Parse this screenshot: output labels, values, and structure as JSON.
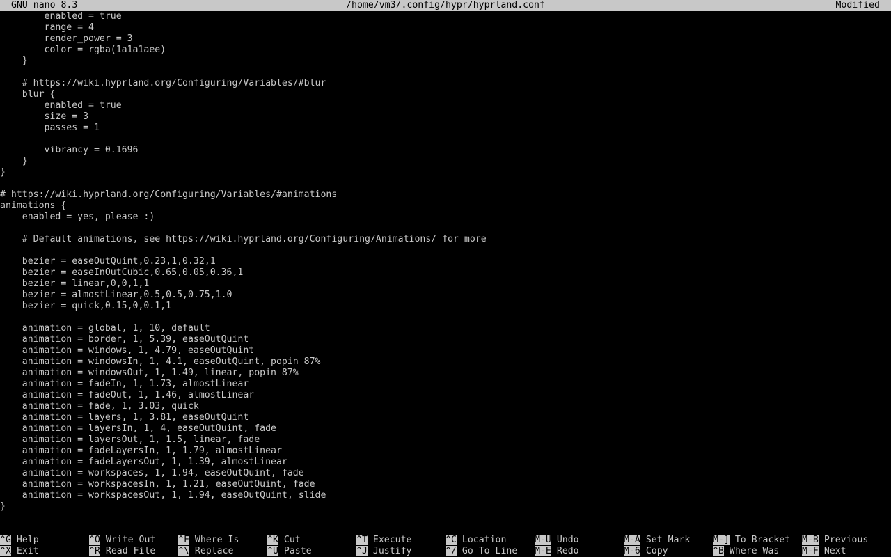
{
  "titlebar": {
    "app": "GNU nano 8.3",
    "file": "/home/vm3/.config/hypr/hyprland.conf",
    "state": "Modified"
  },
  "editor": {
    "lines": [
      "        enabled = true",
      "        range = 4",
      "        render_power = 3",
      "        color = rgba(1a1a1aee)",
      "    }",
      "",
      "    # https://wiki.hyprland.org/Configuring/Variables/#blur",
      "    blur {",
      "        enabled = true",
      "        size = 3",
      "        passes = 1",
      "",
      "        vibrancy = 0.1696",
      "    }",
      "}",
      "",
      "# https://wiki.hyprland.org/Configuring/Variables/#animations",
      "animations {",
      "    enabled = yes, please :)",
      "",
      "    # Default animations, see https://wiki.hyprland.org/Configuring/Animations/ for more",
      "",
      "    bezier = easeOutQuint,0.23,1,0.32,1",
      "    bezier = easeInOutCubic,0.65,0.05,0.36,1",
      "    bezier = linear,0,0,1,1",
      "    bezier = almostLinear,0.5,0.5,0.75,1.0",
      "    bezier = quick,0.15,0,0.1,1",
      "",
      "    animation = global, 1, 10, default",
      "    animation = border, 1, 5.39, easeOutQuint",
      "    animation = windows, 1, 4.79, easeOutQuint",
      "    animation = windowsIn, 1, 4.1, easeOutQuint, popin 87%",
      "    animation = windowsOut, 1, 1.49, linear, popin 87%",
      "    animation = fadeIn, 1, 1.73, almostLinear",
      "    animation = fadeOut, 1, 1.46, almostLinear",
      "    animation = fade, 1, 3.03, quick",
      "    animation = layers, 1, 3.81, easeOutQuint",
      "    animation = layersIn, 1, 4, easeOutQuint, fade",
      "    animation = layersOut, 1, 1.5, linear, fade",
      "    animation = fadeLayersIn, 1, 1.79, almostLinear",
      "    animation = fadeLayersOut, 1, 1.39, almostLinear",
      "    animation = workspaces, 1, 1.94, easeOutQuint, fade",
      "    animation = workspacesIn, 1, 1.21, easeOutQuint, fade",
      "    animation = workspacesOut, 1, 1.94, easeOutQuint, slide",
      "}"
    ]
  },
  "shortcuts": [
    {
      "key": "^G",
      "label": "Help"
    },
    {
      "key": "^O",
      "label": "Write Out"
    },
    {
      "key": "^F",
      "label": "Where Is"
    },
    {
      "key": "^K",
      "label": "Cut"
    },
    {
      "key": "^T",
      "label": "Execute"
    },
    {
      "key": "^C",
      "label": "Location"
    },
    {
      "key": "M-U",
      "label": "Undo"
    },
    {
      "key": "M-A",
      "label": "Set Mark"
    },
    {
      "key": "M-]",
      "label": "To Bracket"
    },
    {
      "key": "M-B",
      "label": "Previous"
    },
    {
      "key": "^X",
      "label": "Exit"
    },
    {
      "key": "^R",
      "label": "Read File"
    },
    {
      "key": "^\\",
      "label": "Replace"
    },
    {
      "key": "^U",
      "label": "Paste"
    },
    {
      "key": "^J",
      "label": "Justify"
    },
    {
      "key": "^/",
      "label": "Go To Line"
    },
    {
      "key": "M-E",
      "label": "Redo"
    },
    {
      "key": "M-6",
      "label": "Copy"
    },
    {
      "key": "^B",
      "label": "Where Was"
    },
    {
      "key": "M-F",
      "label": "Next"
    }
  ]
}
